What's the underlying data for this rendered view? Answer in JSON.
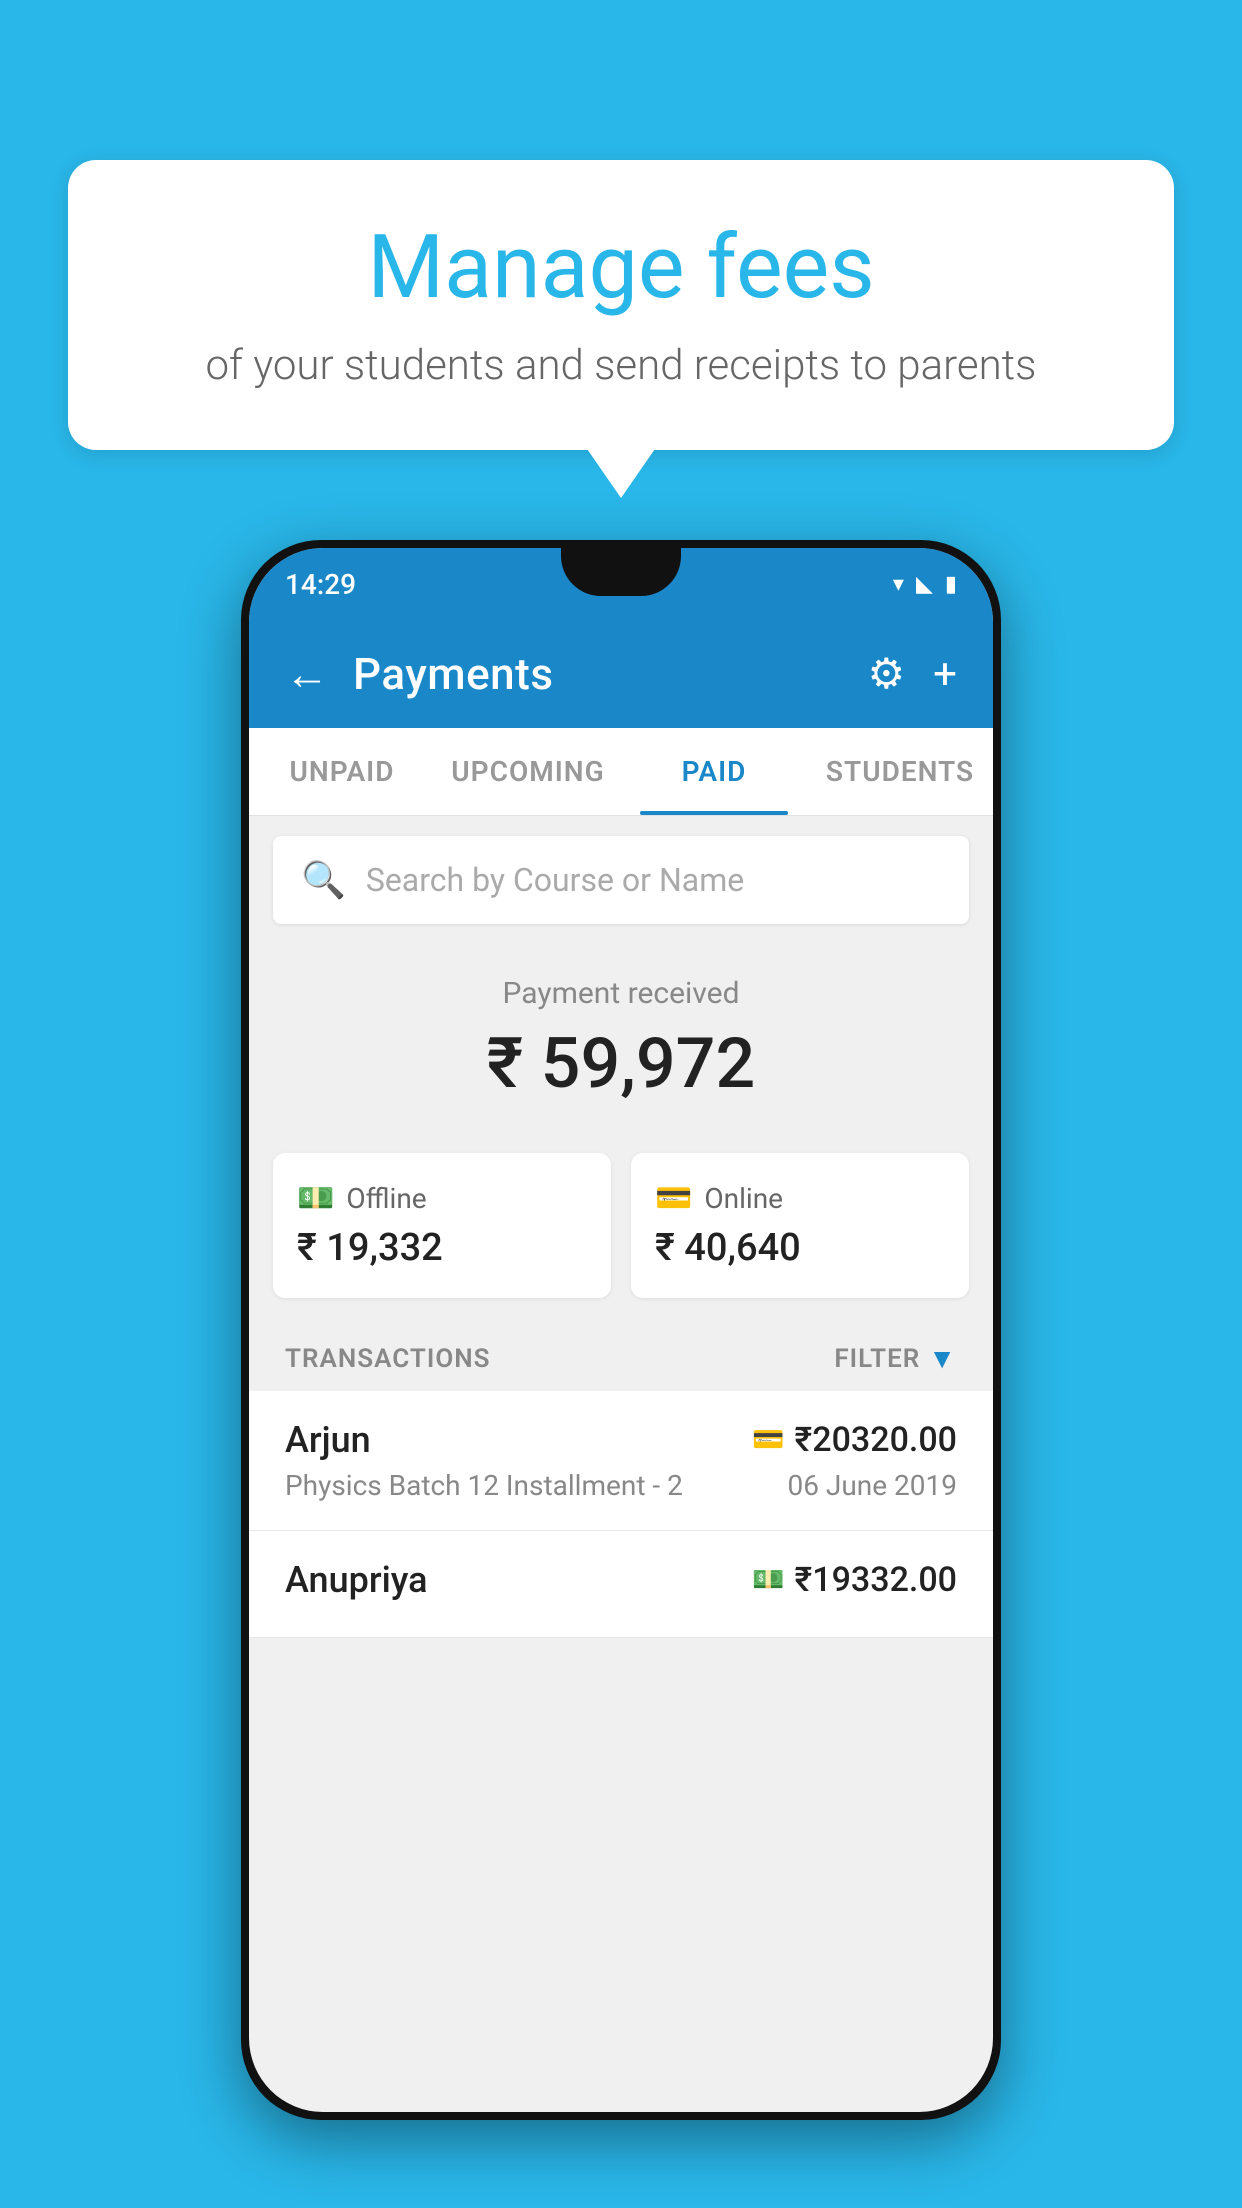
{
  "background_color": "#29b6e8",
  "speech_bubble": {
    "title": "Manage fees",
    "subtitle": "of your students and send receipts to parents"
  },
  "phone": {
    "status_bar": {
      "time": "14:29"
    },
    "app_bar": {
      "title": "Payments",
      "back_icon": "←",
      "settings_icon": "⚙",
      "add_icon": "+"
    },
    "tabs": [
      {
        "label": "UNPAID",
        "active": false
      },
      {
        "label": "UPCOMING",
        "active": false
      },
      {
        "label": "PAID",
        "active": true
      },
      {
        "label": "STUDENTS",
        "active": false
      }
    ],
    "search": {
      "placeholder": "Search by Course or Name"
    },
    "payment_summary": {
      "label": "Payment received",
      "amount": "₹ 59,972",
      "offline": {
        "type": "Offline",
        "amount": "₹ 19,332"
      },
      "online": {
        "type": "Online",
        "amount": "₹ 40,640"
      }
    },
    "transactions": {
      "label": "TRANSACTIONS",
      "filter_label": "FILTER",
      "items": [
        {
          "name": "Arjun",
          "description": "Physics Batch 12 Installment - 2",
          "amount": "₹20320.00",
          "date": "06 June 2019",
          "payment_type": "card"
        },
        {
          "name": "Anupriya",
          "description": "",
          "amount": "₹19332.00",
          "date": "",
          "payment_type": "cash"
        }
      ]
    }
  }
}
